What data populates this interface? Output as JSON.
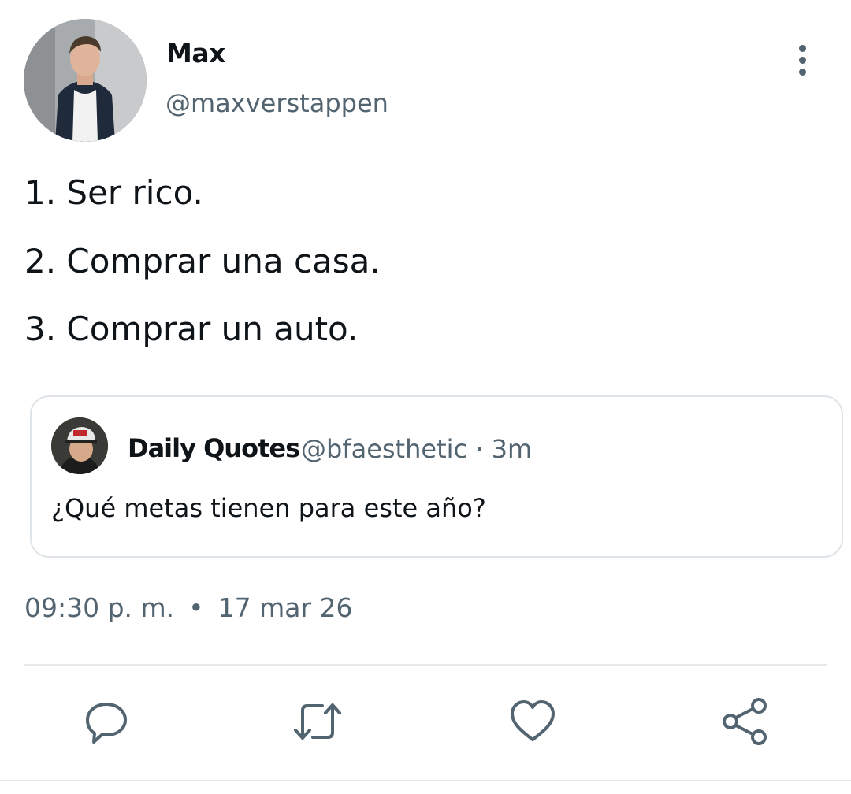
{
  "author": {
    "name": "Max",
    "handle": "@maxverstappen"
  },
  "tweet": {
    "lines": [
      "1. Ser rico.",
      "2. Comprar una casa.",
      "3. Comprar un auto."
    ]
  },
  "quoted": {
    "name": "Daily Quotes",
    "meta": "@bfaesthetic · 3m",
    "text": "¿Qué metas tienen para este año?"
  },
  "timestamp": {
    "time": "09:30 p. m.",
    "separator": "•",
    "date": "17 mar 26"
  },
  "icons": {
    "more": "more-vertical-icon",
    "reply": "reply-icon",
    "retweet": "retweet-icon",
    "like": "heart-icon",
    "share": "share-icon"
  },
  "colors": {
    "text_primary": "#0f1419",
    "text_secondary": "#536471",
    "border": "#dfe4e8"
  }
}
